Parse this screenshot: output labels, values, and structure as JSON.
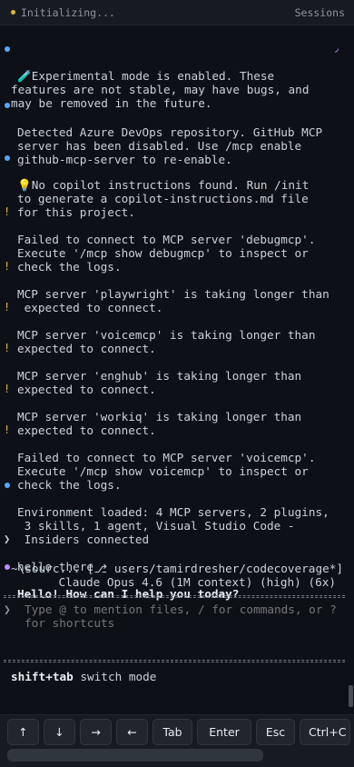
{
  "topbar": {
    "status": "Initializing...",
    "sessions_label": "Sessions",
    "accent": "#e3b341"
  },
  "messages": [
    {
      "kind": "info",
      "text": "🧪Experimental mode is enabled. These\nfeatures are not stable, may have bugs, and\nmay be removed in the future.",
      "color": "#58a6ff"
    },
    {
      "kind": "info",
      "text": "Detected Azure DevOps repository. GitHub MCP\nserver has been disabled. Use /mcp enable\ngithub-mcp-server to re-enable.",
      "color": "#58a6ff"
    },
    {
      "kind": "info",
      "text": "💡No copilot instructions found. Run /init\nto generate a copilot-instructions.md file\nfor this project.",
      "color": "#58a6ff"
    },
    {
      "kind": "warn",
      "text": "Failed to connect to MCP server 'debugmcp'.\nExecute '/mcp show debugmcp' to inspect or\ncheck the logs."
    },
    {
      "kind": "warn",
      "text": "MCP server 'playwright' is taking longer than\n expected to connect."
    },
    {
      "kind": "warn",
      "text": "MCP server 'voicemcp' is taking longer than\nexpected to connect."
    },
    {
      "kind": "warn",
      "text": "MCP server 'enghub' is taking longer than\nexpected to connect."
    },
    {
      "kind": "warn",
      "text": "MCP server 'workiq' is taking longer than\nexpected to connect."
    },
    {
      "kind": "warn",
      "text": "Failed to connect to MCP server 'voicemcp'.\nExecute '/mcp show voicemcp' to inspect or\ncheck the logs."
    },
    {
      "kind": "info",
      "text": "Environment loaded: 4 MCP servers, 2 plugins,\n 3 skills, 1 agent, Visual Studio Code -\n Insiders connected",
      "color": "#58a6ff"
    },
    {
      "kind": "user",
      "text": "hello there"
    },
    {
      "kind": "assistant",
      "text": "Hello! How can I help you today?",
      "color": "#bc8cff"
    }
  ],
  "status_line": {
    "path": "~\\sourc... [⎇ users/tamirdresher/codecoverage*]",
    "model": "Claude Opus 4.6 (1M context) (high) (6x)"
  },
  "prompt": {
    "symbol": "❯",
    "placeholder": "Type @ to mention files, / for commands, or ? for shortcuts",
    "value": ""
  },
  "hint": {
    "key": "shift+tab",
    "action": "switch mode"
  },
  "keys": [
    "↑",
    "↓",
    "→",
    "←",
    "Tab",
    "Enter",
    "Esc",
    "Ctrl+C"
  ]
}
